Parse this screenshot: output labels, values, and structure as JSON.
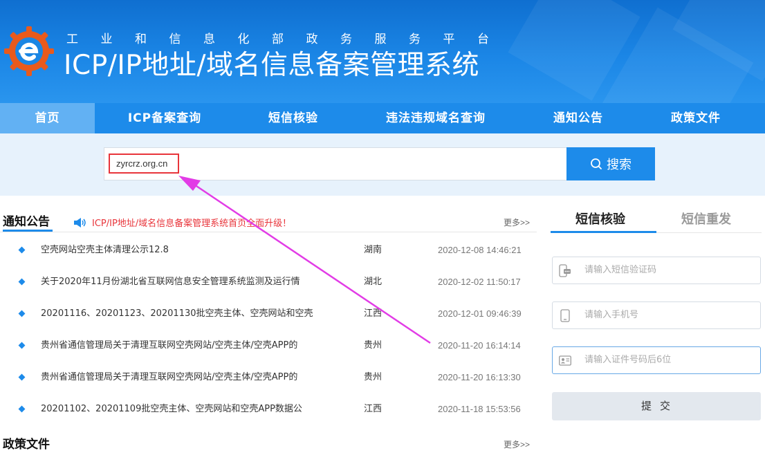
{
  "header": {
    "subtitle": "工业和信息化部政务服务平台",
    "title": "ICP/IP地址/域名信息备案管理系统",
    "logo_icon": "gear-e-logo-icon"
  },
  "nav": {
    "items": [
      {
        "label": "首页",
        "active": true
      },
      {
        "label": "ICP备案查询"
      },
      {
        "label": "短信核验"
      },
      {
        "label": "违法违规域名查询"
      },
      {
        "label": "通知公告"
      },
      {
        "label": "政策文件"
      }
    ]
  },
  "search": {
    "value": "zyrcrz.org.cn",
    "button_label": "搜索",
    "button_icon": "search-icon"
  },
  "notice": {
    "title": "通知公告",
    "marquee": "ICP/IP地址/域名信息备案管理系统首页全面升级！",
    "more": "更多>>",
    "rows": [
      {
        "title": "空壳网站空壳主体清理公示12.8",
        "province": "湖南",
        "date": "2020-12-08 14:46:21"
      },
      {
        "title": "关于2020年11月份湖北省互联网信息安全管理系统监测及运行情",
        "province": "湖北",
        "date": "2020-12-02 11:50:17"
      },
      {
        "title": "20201116、20201123、20201130批空壳主体、空壳网站和空壳",
        "province": "江西",
        "date": "2020-12-01 09:46:39"
      },
      {
        "title": "贵州省通信管理局关于清理互联网空壳网站/空壳主体/空壳APP的",
        "province": "贵州",
        "date": "2020-11-20 16:14:14"
      },
      {
        "title": "贵州省通信管理局关于清理互联网空壳网站/空壳主体/空壳APP的",
        "province": "贵州",
        "date": "2020-11-20 16:13:30"
      },
      {
        "title": "20201102、20201109批空壳主体、空壳网站和空壳APP数据公",
        "province": "江西",
        "date": "2020-11-18 15:53:56"
      }
    ]
  },
  "policy": {
    "title": "政策文件",
    "more": "更多>>"
  },
  "sms": {
    "tab_verify": "短信核验",
    "tab_resend": "短信重发",
    "code_placeholder": "请输入短信验证码",
    "phone_placeholder": "请输入手机号",
    "id_placeholder": "请输入证件号码后6位",
    "submit_label": "提交"
  },
  "colors": {
    "primary": "#1d8bea",
    "nav_active": "#62b1f3",
    "highlight_red": "#e8343a",
    "annotation_arrow": "#e23ce6"
  }
}
